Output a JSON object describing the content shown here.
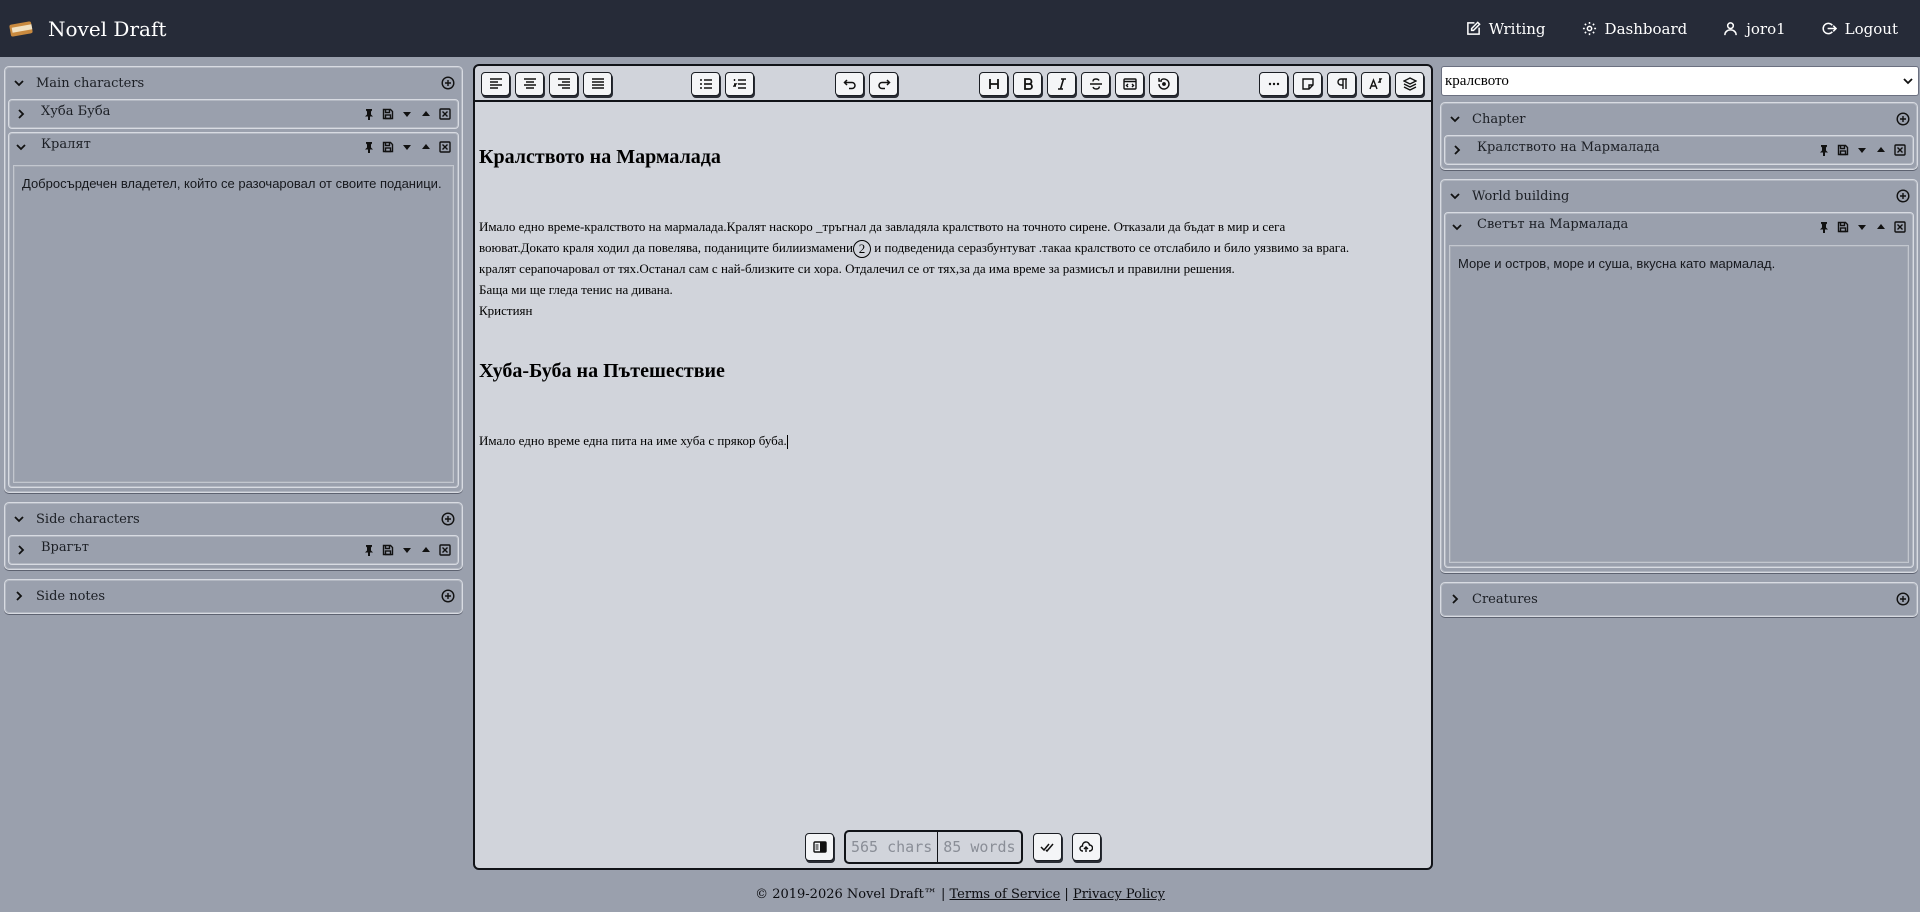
{
  "app": {
    "name": "Novel Draft"
  },
  "nav": {
    "writing": "Writing",
    "dashboard": "Dashboard",
    "user": "joro1",
    "logout": "Logout"
  },
  "left_sidebar": {
    "main_characters": {
      "title": "Main characters",
      "items": [
        {
          "name": "Хуба Буба"
        },
        {
          "name": "Кралят",
          "body": "Добросърдечен владетел, който се разочаровал от своите поданици."
        }
      ]
    },
    "side_characters": {
      "title": "Side characters",
      "items": [
        {
          "name": "Врагът"
        }
      ]
    },
    "side_notes": {
      "title": "Side notes"
    }
  },
  "editor": {
    "heading1": "Кралството на Мармалада",
    "para1_line1": "Имало едно време-кралството на мармалада.Кралят наскоро _тръгнал да завладяла кралството на точното сирене. Отказали да бъдат в мир и сега",
    "para1_line2_a": "воюват.Докато краля ходил да повелява, поданиците билиизмамени",
    "note_ref": "2",
    "para1_line2_b": " и подведенида серазбунтуват .такаа кралството се отслабило и било уязвимо за врага.",
    "para1_line3": "кралят серапочаровал от тях.Останал сам с най-близките си хора. Отдалечил се от тях,за да има време за размисъл и правилни решения.",
    "para1_line4": "Баща ми ще гледа тенис на дивана.",
    "para1_line5": "Кристиян",
    "heading2": "Хуба-Буба на Пътешествие",
    "para2": "Имало едно време една пита на име хуба с прякор буба.",
    "chars": "565 chars",
    "words": "85 words"
  },
  "right_sidebar": {
    "search": {
      "value": "кралсвото"
    },
    "chapter": {
      "title": "Chapter",
      "items": [
        {
          "name": "Кралството на Мармалада"
        }
      ]
    },
    "world_building": {
      "title": "World building",
      "items": [
        {
          "name": "Светът на Мармалада",
          "body": "Море и остров, море и суша, вкусна като мармалад."
        }
      ]
    },
    "creatures": {
      "title": "Creatures"
    }
  },
  "footer": {
    "copyright": "© 2019-2026 Novel Draft™",
    "separator1": "|",
    "terms": "Terms of Service",
    "separator2": "|",
    "privacy": "Privacy Policy"
  },
  "colors": {
    "navbar": "#262b38",
    "background": "#9aa0ad",
    "editor_bg": "#d1d4db"
  }
}
